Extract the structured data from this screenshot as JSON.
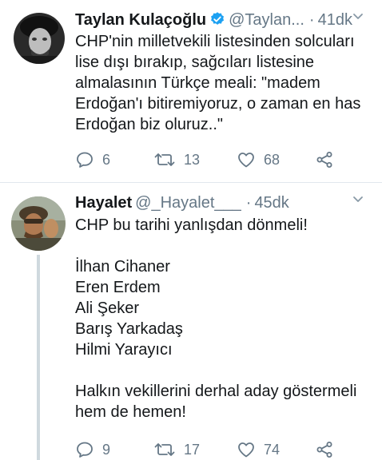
{
  "tweets": [
    {
      "name": "Taylan Kulaçoğlu",
      "handle": "@Taylan...",
      "dot": "·",
      "time": "41dk",
      "text": "CHP'nin milletvekili listesinden solcuları\nlise dışı bırakıp, sağcıları listesine\nalmalasının Türkçe meali: \"madem\nErdoğan'ı bitiremiyoruz, o zaman en has\nErdoğan biz oluruz..\"",
      "verified": true,
      "replies": "6",
      "retweets": "13",
      "likes": "68"
    },
    {
      "name": "Hayalet",
      "handle": "@_Hayalet___",
      "dot": "·",
      "time": "45dk",
      "text": "CHP bu tarihi yanlışdan dönmeli!\n\nİlhan Cihaner\nEren Erdem\nAli Şeker\nBarış Yarkadaş\nHilmi Yarayıcı\n\nHalkın vekillerini derhal aday göstermeli\nhem de hemen!",
      "verified": false,
      "replies": "9",
      "retweets": "17",
      "likes": "74"
    }
  ],
  "icons": {
    "reply": "reply-icon",
    "retweet": "retweet-icon",
    "like": "heart-icon",
    "share": "share-icon",
    "caret": "chevron-down-icon",
    "verified": "verified-badge-icon"
  },
  "colors": {
    "text": "#14171a",
    "secondary": "#657786",
    "verified": "#1da1f2",
    "divider": "#e1e8ed",
    "thread": "#cfd9de"
  }
}
